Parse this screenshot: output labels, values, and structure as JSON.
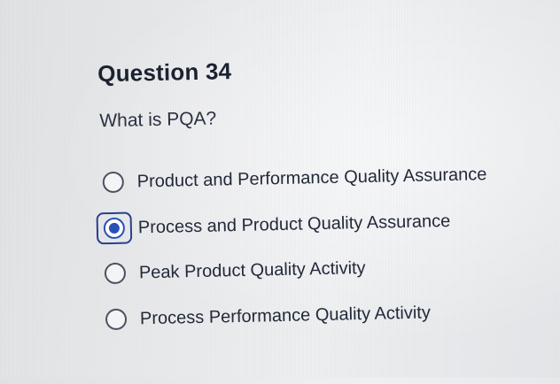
{
  "question": {
    "title": "Question 34",
    "prompt": "What is PQA?"
  },
  "options": [
    {
      "label": "Product and Performance Quality Assurance",
      "selected": false
    },
    {
      "label": "Process and Product Quality Assurance",
      "selected": true
    },
    {
      "label": "Peak Product Quality Activity",
      "selected": false
    },
    {
      "label": "Process Performance Quality Activity",
      "selected": false
    }
  ],
  "colors": {
    "accent": "#2a50b8",
    "focus_ring": "#2a3f8f",
    "text": "#1c2230"
  },
  "icons": {
    "radio_unselected": "radio-button-empty-icon",
    "radio_selected": "radio-button-checked-icon"
  }
}
